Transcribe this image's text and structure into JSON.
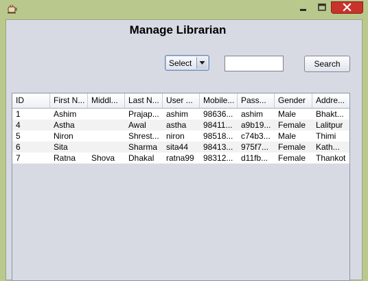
{
  "window": {
    "title": ""
  },
  "header": {
    "title": "Manage Librarian"
  },
  "filter": {
    "select_label": "Select",
    "search_value": "",
    "search_button": "Search"
  },
  "table": {
    "columns": [
      "ID",
      "First N...",
      "Middl...",
      "Last N...",
      "User ...",
      "Mobile...",
      "Pass...",
      "Gender",
      "Addre..."
    ],
    "rows": [
      [
        "1",
        "Ashim",
        "",
        "Prajap...",
        "ashim",
        "98636...",
        "ashim",
        "Male",
        "Bhakt..."
      ],
      [
        "4",
        "Astha",
        "",
        "Awal",
        "astha",
        "98411...",
        "a9b19...",
        "Female",
        "Lalitpur"
      ],
      [
        "5",
        "Niron",
        "",
        "Shrest...",
        "niron",
        "98518...",
        "c74b3...",
        "Male",
        "Thimi"
      ],
      [
        "6",
        "Sita",
        "",
        "Sharma",
        "sita44",
        "98413...",
        "975f7...",
        "Female",
        "Kath..."
      ],
      [
        "7",
        "Ratna",
        "Shova",
        "Dhakal",
        "ratna99",
        "98312...",
        "d11fb...",
        "Female",
        "Thankot"
      ]
    ]
  },
  "colors": {
    "titlebar": "#b9c98d",
    "client": "#d7dae3",
    "close": "#c7342b"
  },
  "icons": {
    "app": "java-coffee-cup-icon",
    "minimize": "minimize-icon",
    "maximize": "maximize-icon",
    "close": "close-icon",
    "dropdown": "dropdown-arrow-icon"
  }
}
